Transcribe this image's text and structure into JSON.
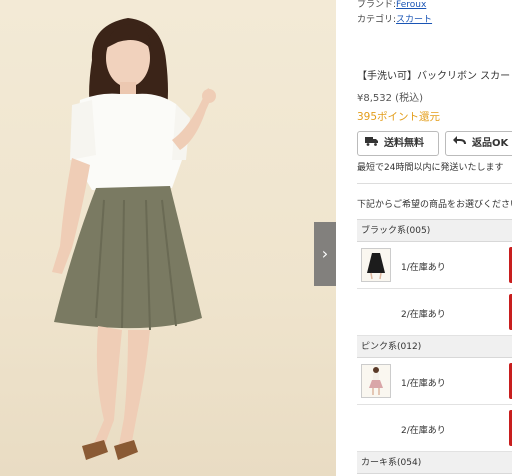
{
  "meta": {
    "brand_label": "ブランド:",
    "brand_value": "Feroux",
    "category_label": "カテゴリ:",
    "category_value": "スカート"
  },
  "product": {
    "title": "【手洗い可】バックリボン スカート",
    "price": "¥8,532 (税込)",
    "points": "395ポイント還元"
  },
  "badges": {
    "shipping": "送料無料",
    "returns": "返品OK"
  },
  "shipping_note": "最短で24時間以内に発送いたします",
  "select_note": "下記からご希望の商品をお選びください",
  "variants": [
    {
      "label": "ブラック系(005)",
      "rows": [
        {
          "stock": "1/在庫あり",
          "thumb": "black-skirt"
        },
        {
          "stock": "2/在庫あり",
          "thumb": ""
        }
      ]
    },
    {
      "label": "ピンク系(012)",
      "rows": [
        {
          "stock": "1/在庫あり",
          "thumb": "pink-skirt-model"
        },
        {
          "stock": "2/在庫あり",
          "thumb": ""
        }
      ]
    },
    {
      "label": "カーキ系(054)",
      "rows": []
    }
  ],
  "colors": {
    "link": "#1a55b5",
    "points": "#e39d1a",
    "add_button": "#c81e1e",
    "skirt": "#7a7a62"
  },
  "icons": {
    "next": "chevron-right-icon",
    "shipping": "truck-icon",
    "returns": "return-arrow-icon"
  }
}
